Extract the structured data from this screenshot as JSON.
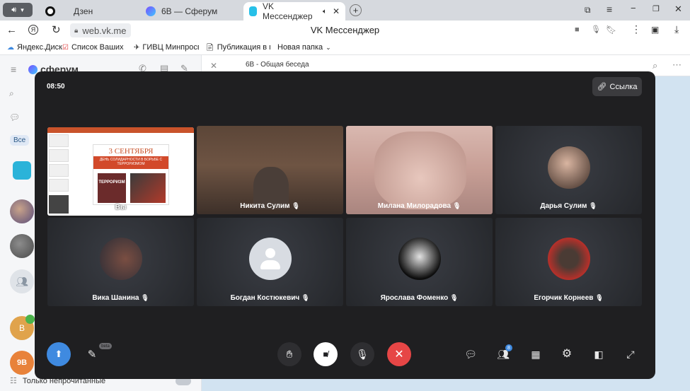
{
  "tabs": [
    {
      "label": "Дзен"
    },
    {
      "label": "6В — Сферум"
    },
    {
      "label": "VK Мессенджер"
    }
  ],
  "address": {
    "url": "web.vk.me",
    "page_title": "VK Мессенджер"
  },
  "bookmarks": [
    {
      "label": "Яндекс.Диск"
    },
    {
      "label": "Список Ваших за"
    },
    {
      "label": "ГИВЦ Минпросв"
    },
    {
      "label": "Публикация в пе"
    },
    {
      "label": "Новая папка"
    }
  ],
  "sidebar": {
    "logo": "сферум",
    "filter_all": "Все",
    "unread_only": "Только непрочитанные",
    "avatar_text_1": "В",
    "avatar_text_2": "9В"
  },
  "chat": {
    "title": "6В - Общая беседа"
  },
  "call": {
    "timer": "08:50",
    "link_label": "Ссылка",
    "participants": [
      {
        "name": "Вы"
      },
      {
        "name": "Никита Сулим"
      },
      {
        "name": "Милана Милорадова"
      },
      {
        "name": "Дарья Сулим"
      },
      {
        "name": "Вика Шанина"
      },
      {
        "name": "Богдан Костюкевич"
      },
      {
        "name": "Ярослава Фоменко"
      },
      {
        "name": "Егорчик Корнеев"
      }
    ],
    "slide": {
      "heading": "3 СЕНТЯБРЯ",
      "subheading": "ДЕНЬ СОЛИДАРНОСТИ В БОРЬБЕ С ТЕРРОРИЗМОМ",
      "poster_text": "ТЕРРОРИЗМ"
    },
    "participants_badge": "8",
    "beta_label": "beta"
  },
  "colors": {
    "modal_bg": "#1f1f21",
    "end_call": "#e64646",
    "accent_blue": "#3f8ae0"
  }
}
